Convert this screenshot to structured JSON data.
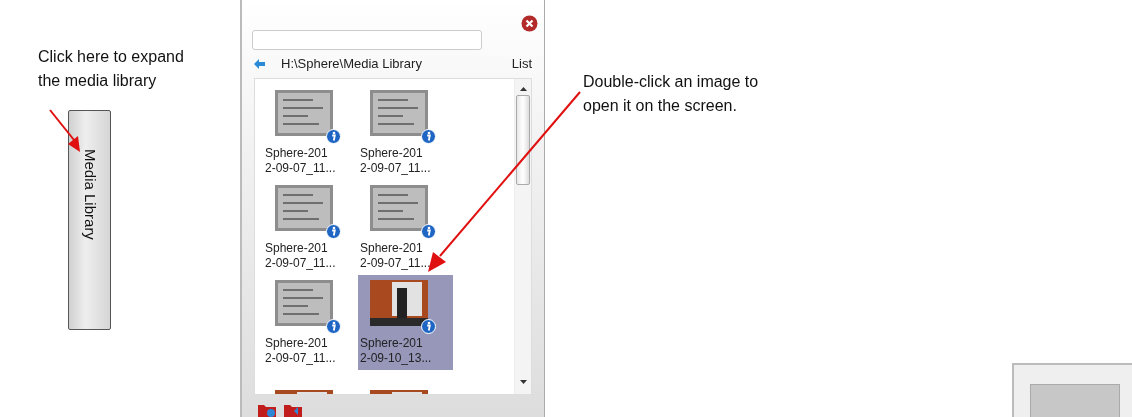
{
  "callouts": [
    {
      "text": "Click here to expand the media library"
    },
    {
      "text": "Double-click an image to open it on the screen."
    }
  ],
  "side_tab": {
    "label": "Media Library"
  },
  "panel": {
    "path": "H:\\Sphere\\Media Library",
    "view_toggle": "List",
    "items": [
      {
        "kind": "document",
        "lines": [
          "Sphere-201",
          "2-09-07_11..."
        ],
        "selected": false
      },
      {
        "kind": "document",
        "lines": [
          "Sphere-201",
          "2-09-07_11..."
        ],
        "selected": false
      },
      {
        "kind": "document",
        "lines": [
          "Sphere-201",
          "2-09-07_11..."
        ],
        "selected": false
      },
      {
        "kind": "document",
        "lines": [
          "Sphere-201",
          "2-09-07_11..."
        ],
        "selected": false
      },
      {
        "kind": "document",
        "lines": [
          "Sphere-201",
          "2-09-07_11..."
        ],
        "selected": false
      },
      {
        "kind": "scene",
        "lines": [
          "Sphere-201",
          "2-09-10_13..."
        ],
        "selected": true
      },
      {
        "kind": "scene",
        "selected": false
      },
      {
        "kind": "scene",
        "selected": false
      }
    ]
  }
}
